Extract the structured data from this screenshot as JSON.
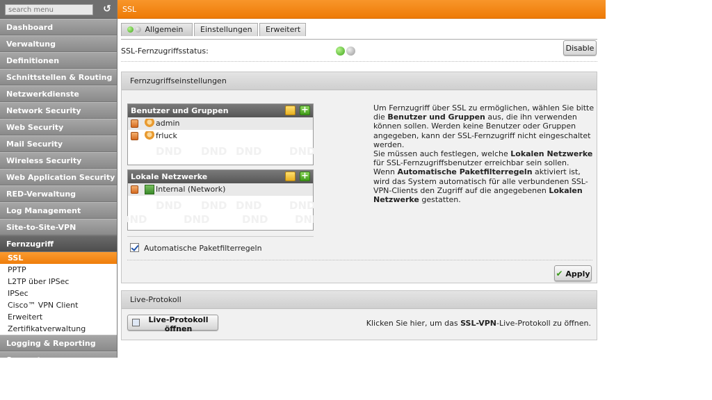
{
  "search": {
    "placeholder": "search menu"
  },
  "sidebar": {
    "items_top": [
      "Dashboard",
      "Verwaltung",
      "Definitionen",
      "Schnittstellen & Routing",
      "Netzwerkdienste",
      "Network Security",
      "Web Security",
      "Mail Security",
      "Wireless Security",
      "Web Application Security",
      "RED-Verwaltung",
      "Log Management",
      "Site-to-Site-VPN"
    ],
    "active_group": "Fernzugriff",
    "sub_items": [
      "SSL",
      "PPTP",
      "L2TP über IPSec",
      "IPSec",
      "Cisco™ VPN Client",
      "Erweitert",
      "Zertifikatverwaltung"
    ],
    "items_bottom": [
      "Logging & Reporting",
      "Support"
    ]
  },
  "topbar": {
    "title": "SSL"
  },
  "tabs": [
    "Allgemein",
    "Einstellungen",
    "Erweitert"
  ],
  "status": {
    "label": "SSL-Fernzugriffsstatus:",
    "button": "Disable"
  },
  "settings_panel": {
    "title": "Fernzugriffseinstellungen",
    "users_box": {
      "title": "Benutzer und Gruppen",
      "entries": [
        "admin",
        "frluck"
      ]
    },
    "networks_box": {
      "title": "Lokale Netzwerke",
      "entries": [
        "Internal (Network)"
      ]
    },
    "watermark": "DND",
    "checkbox_label": "Automatische Paketfilterregeln",
    "apply_label": "Apply",
    "info": {
      "p1": "Um Fernzugriff über SSL zu ermöglichen, wählen Sie bitte die",
      "p1b": "Benutzer und Gruppen",
      "p1c": "aus, die ihn verwenden können sollen. Werden keine Benutzer oder Gruppen angegeben, kann der SSL-Fernzugriff nicht eingeschaltet werden.",
      "p2": "Sie müssen auch festlegen, welche",
      "p2b": "Lokalen Netzwerke",
      "p2c": "für SSL-Fernzugriffsbenutzer erreichbar sein sollen.",
      "p3": "Wenn",
      "p3b": "Automatische Paketfilterregeln",
      "p3c": "aktiviert ist, wird das System automatisch für alle verbundenen SSL-VPN-Clients den Zugriff auf die angegebenen",
      "p3d": "Lokalen Netzwerke",
      "p3e": "gestatten."
    }
  },
  "live_panel": {
    "title": "Live-Protokoll",
    "button": "Live-Protokoll öffnen",
    "hint_a": "Klicken Sie hier, um das",
    "hint_b": "SSL-VPN",
    "hint_c": "-Live-Protokoll zu öffnen."
  },
  "colors": {
    "accent": "#f08a1c",
    "sidebar": "#8e8e8e"
  }
}
